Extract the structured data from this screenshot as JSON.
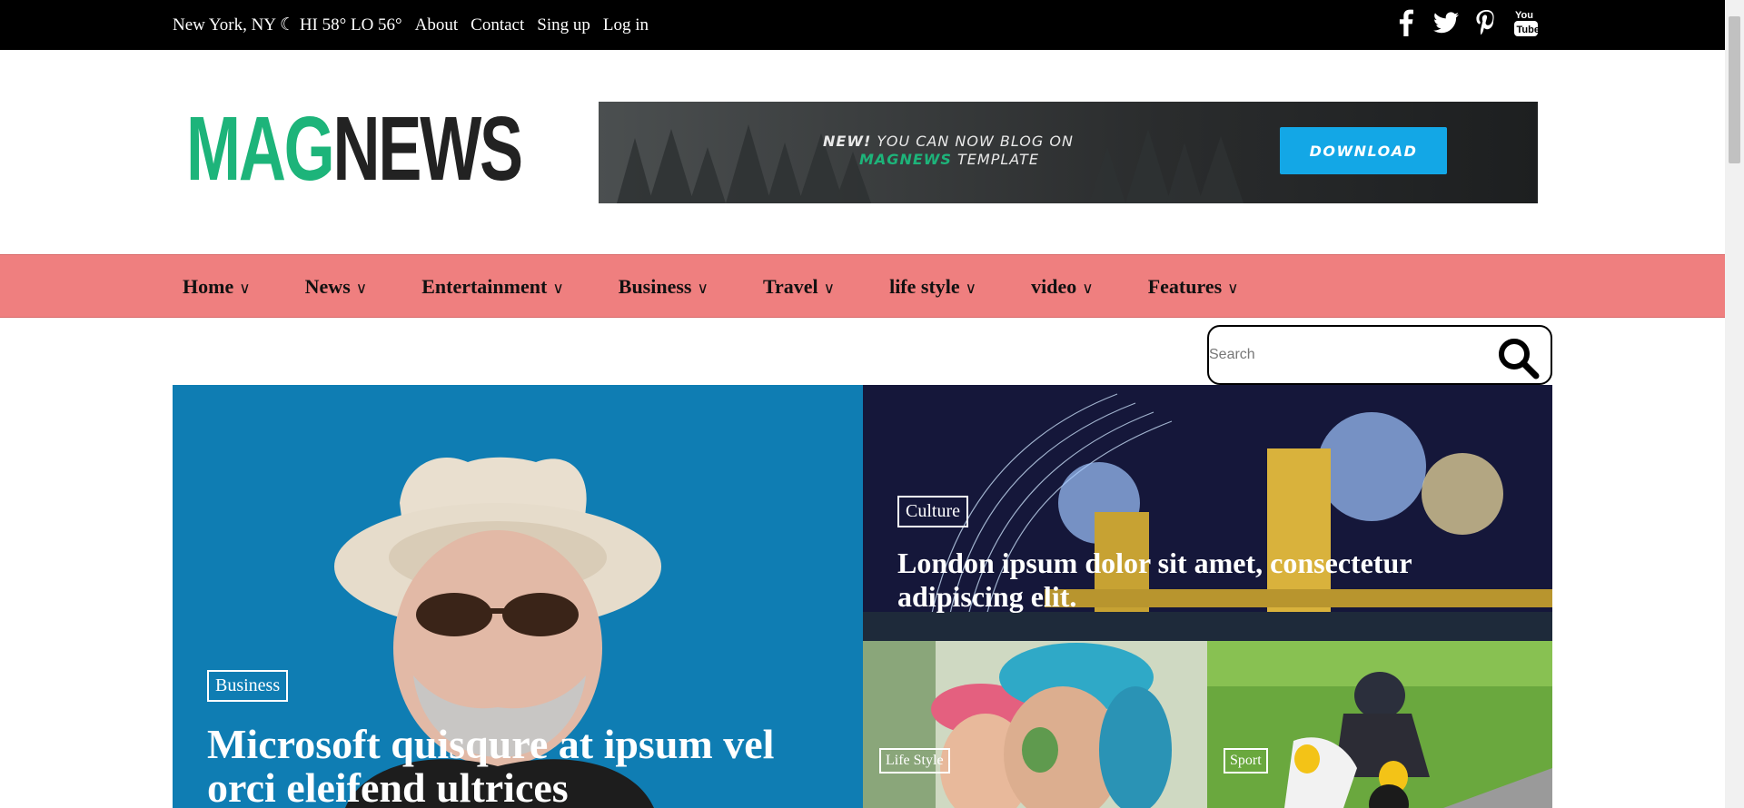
{
  "topbar": {
    "weather": "New York, NY ☾ HI 58° LO 56°",
    "links": [
      "About",
      "Contact",
      "Sing up",
      "Log in"
    ],
    "social": [
      "facebook-icon",
      "twitter-icon",
      "pinterest-icon",
      "youtube-icon"
    ]
  },
  "header": {
    "logo_mag": "MAG",
    "logo_news": "NEWS",
    "banner": {
      "line1_bold": "NEW!",
      "line1_rest": " YOU CAN NOW BLOG ON",
      "line2_brand": "MAGNEWS",
      "line2_rest": " TEMPLATE",
      "button": "DOWNLOAD"
    }
  },
  "nav": {
    "items": [
      "Home",
      "News",
      "Entertainment",
      "Business",
      "Travel",
      "life style",
      "video",
      "Features"
    ],
    "chevron": "∨"
  },
  "search": {
    "placeholder": "Search"
  },
  "hero": {
    "main": {
      "tag": "Business",
      "title": "Microsoft quisqure at ipsum vel orci eleifend ultrices"
    },
    "top_right": {
      "tag": "Culture",
      "title": "London ipsum dolor sit amet, consectetur adipiscing elit."
    },
    "bottom_left": {
      "tag": "Life Style",
      "title": ""
    },
    "bottom_right": {
      "tag": "Sport",
      "title": ""
    }
  },
  "colors": {
    "brand_green": "#1db47a",
    "nav_bg": "#ef7f7f",
    "download_blue": "#13a7e6"
  }
}
